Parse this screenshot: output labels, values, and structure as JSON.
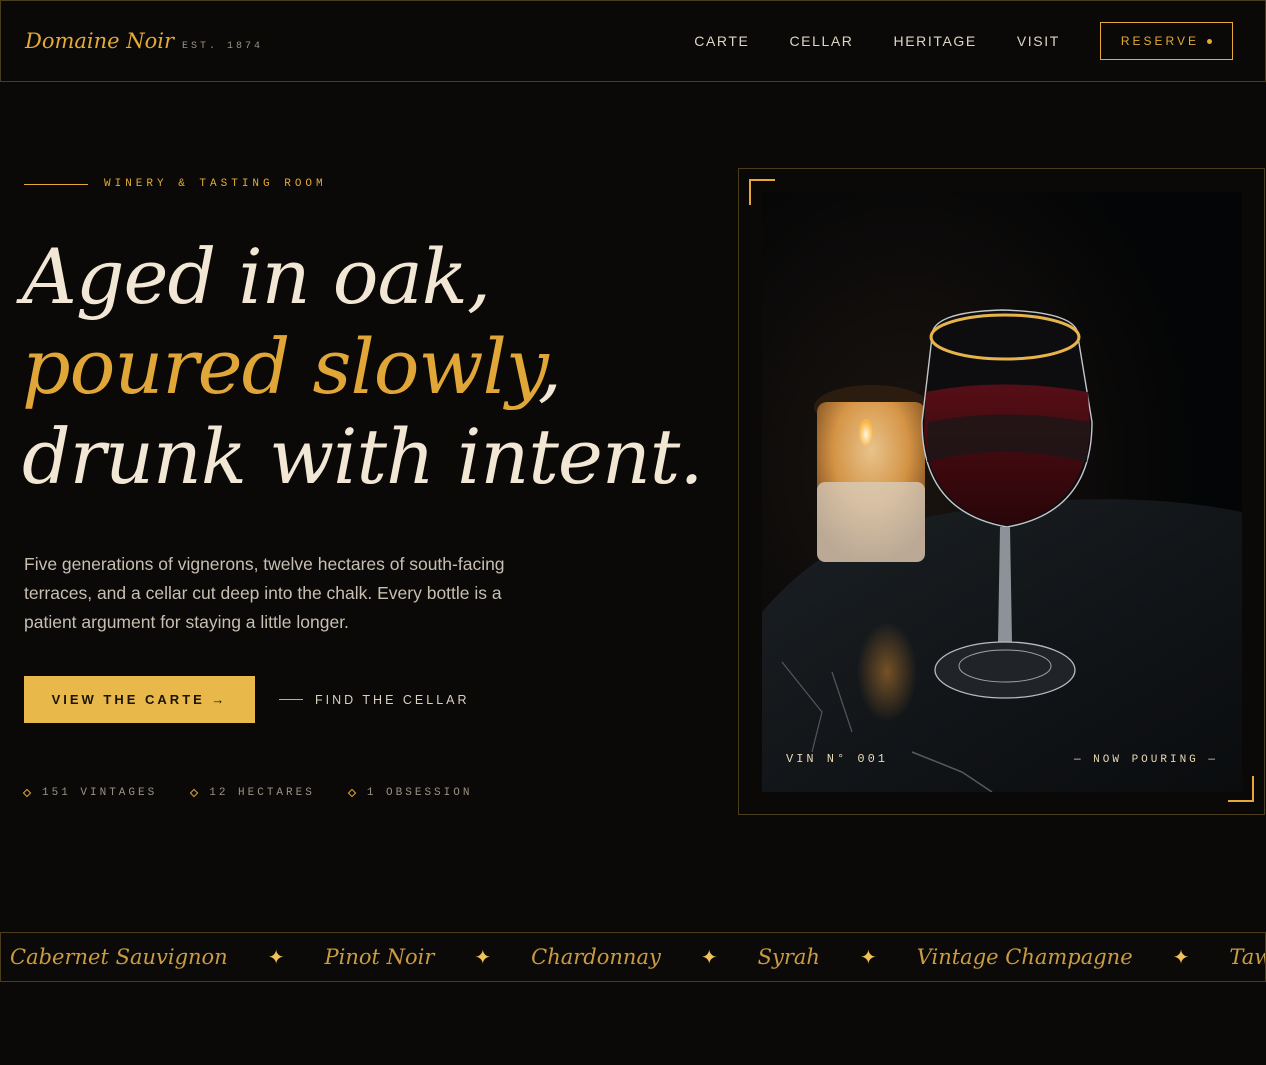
{
  "nav": {
    "brand": "Domaine Noir",
    "established": "EST. 1874",
    "links": [
      "CARTE",
      "CELLAR",
      "HERITAGE",
      "VISIT"
    ],
    "reserve_label": "RESERVE"
  },
  "hero": {
    "eyebrow": "WINERY & TASTING ROOM",
    "headline": {
      "line1": "Aged in oak,",
      "line2_gold": "poured slowly",
      "line2_rest": ",",
      "line3": "drunk with intent."
    },
    "lede": "Five generations of vignerons, twelve hectares of south-facing terraces, and a cellar cut deep into the chalk. Every bottle is a patient argument for staying a little longer.",
    "primary_cta": "VIEW THE CARTE →",
    "secondary_cta": "FIND THE CELLAR",
    "stats": [
      "151 VINTAGES",
      "12 HECTARES",
      "1 OBSESSION"
    ]
  },
  "feature_image": {
    "caption_left": "VIN N° 001",
    "caption_right": "— NOW POURING —"
  },
  "ticker": {
    "items": [
      "Cabernet Sauvignon",
      "Pinot Noir",
      "Chardonnay",
      "Syrah",
      "Vintage Champagne",
      "Tawny Port"
    ],
    "separator": "✦"
  },
  "colors": {
    "background": "#0a0908",
    "accent_gold": "#e4a937",
    "button_gold": "#e9b84a",
    "cream": "#f1e7d4",
    "border": "#4a3d1c"
  }
}
